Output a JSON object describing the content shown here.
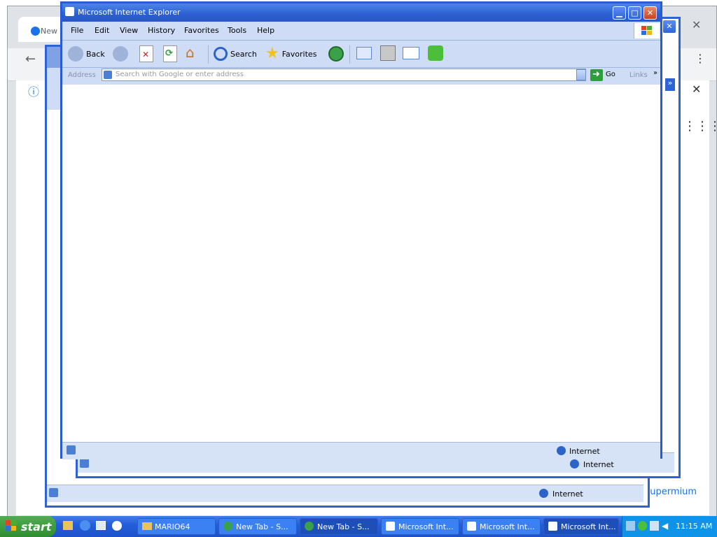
{
  "chrome": {
    "tab_label": "New",
    "footer_link": "Supermium"
  },
  "ie_back": {
    "status_text_win2": "Internet",
    "status_text_win3": "Internet"
  },
  "ie": {
    "title": "Microsoft Internet Explorer",
    "menu": [
      {
        "label": "File"
      },
      {
        "label": "Edit"
      },
      {
        "label": "View"
      },
      {
        "label": "History"
      },
      {
        "label": "Favorites"
      },
      {
        "label": "Tools"
      },
      {
        "label": "Help"
      }
    ],
    "toolbar": {
      "back": "Back",
      "search": "Search",
      "favorites": "Favorites"
    },
    "address": {
      "label": "Address",
      "placeholder": "Search with Google or enter address",
      "go": "Go",
      "links": "Links"
    },
    "status": "Internet"
  },
  "taskbar": {
    "start": "start",
    "tasks": [
      {
        "label": "MARIO64"
      },
      {
        "label": "New Tab - S..."
      },
      {
        "label": "New Tab - S..."
      },
      {
        "label": "Microsoft Int..."
      },
      {
        "label": "Microsoft Int..."
      },
      {
        "label": "Microsoft Int..."
      }
    ],
    "clock": "11:15 AM"
  },
  "colors": {
    "ie_frame": "#2a5bd7",
    "ie_bars": "#cfdcf5",
    "taskbar": "#245edb",
    "start": "#2f8c31",
    "tray": "#0f93e8"
  }
}
